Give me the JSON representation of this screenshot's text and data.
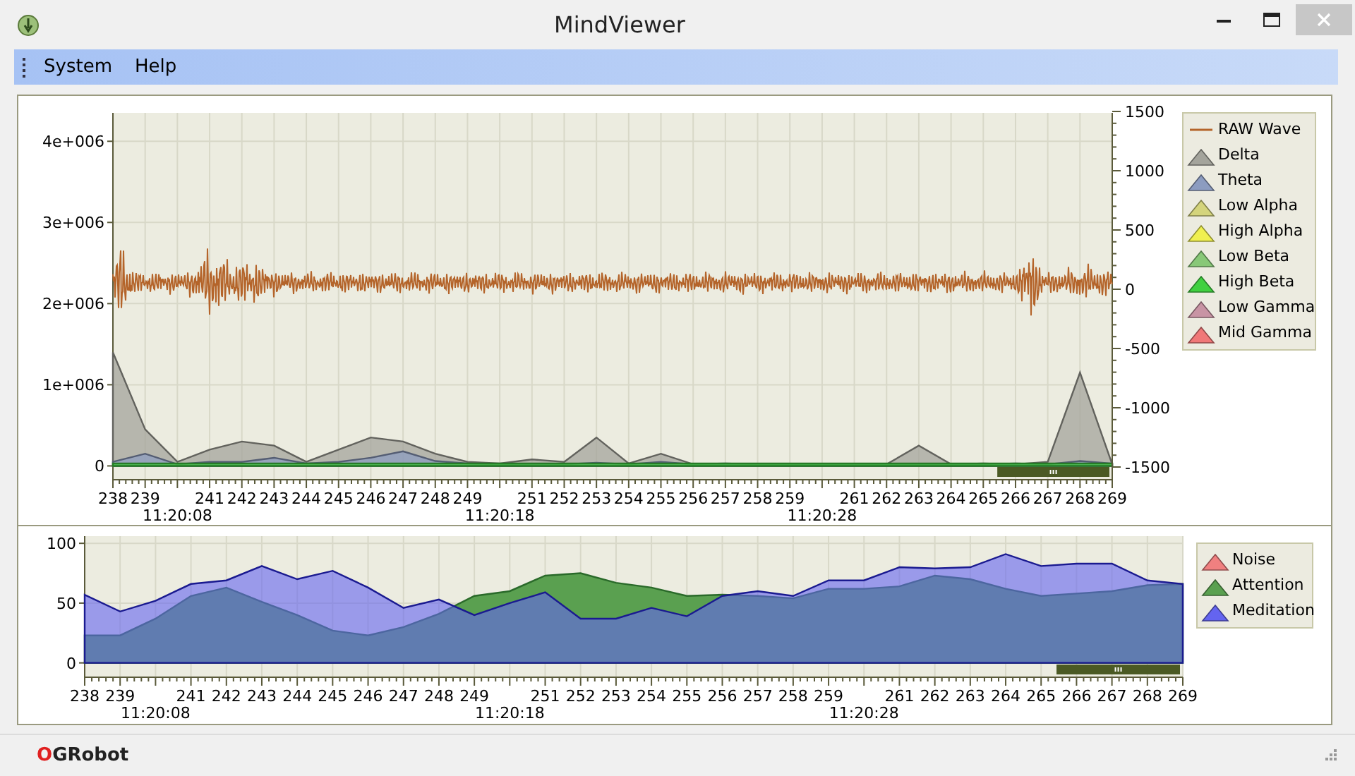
{
  "window": {
    "title": "MindViewer"
  },
  "menu": [
    {
      "label": "System"
    },
    {
      "label": "Help"
    }
  ],
  "wave_chart": {
    "raw_wave": {
      "name": "RAW Wave",
      "color": "#b4642a"
    },
    "right_ytick_labels": [
      "1500",
      "1000",
      "500",
      "0",
      "-500",
      "-1000",
      "-1500"
    ],
    "chart_data": {
      "type": "area",
      "stacked": false,
      "grid": true,
      "legend": true,
      "categories": [
        "238",
        "239",
        "11:20:08",
        "241",
        "242",
        "243",
        "244",
        "245",
        "246",
        "247",
        "248",
        "249",
        "11:20:18",
        "251",
        "252",
        "253",
        "254",
        "255",
        "256",
        "257",
        "258",
        "259",
        "11:20:28",
        "261",
        "262",
        "263",
        "264",
        "265",
        "266",
        "267",
        "268",
        "269"
      ],
      "ylim": [
        -170000,
        4350000
      ],
      "yticks": [
        {
          "value": 0,
          "label": "0"
        },
        {
          "value": 1000000,
          "label": "1e+006"
        },
        {
          "value": 2000000,
          "label": "2e+006"
        },
        {
          "value": 3000000,
          "label": "3e+006"
        },
        {
          "value": 4000000,
          "label": "4e+006"
        }
      ],
      "series": [
        {
          "name": "Delta",
          "color": "#a4a49c",
          "values": [
            1400000,
            450000,
            50000,
            200000,
            300000,
            250000,
            50000,
            200000,
            350000,
            300000,
            150000,
            50000,
            30000,
            80000,
            50000,
            350000,
            30000,
            150000,
            20000,
            20000,
            20000,
            20000,
            20000,
            20000,
            20000,
            250000,
            20000,
            30000,
            20000,
            50000,
            1150000,
            20000
          ]
        },
        {
          "name": "Theta",
          "color": "#8c9cc0",
          "values": [
            50000,
            150000,
            20000,
            50000,
            50000,
            100000,
            30000,
            50000,
            100000,
            180000,
            60000,
            30000,
            20000,
            20000,
            20000,
            40000,
            20000,
            50000,
            20000,
            30000,
            20000,
            20000,
            20000,
            20000,
            20000,
            20000,
            20000,
            20000,
            30000,
            20000,
            60000,
            30000
          ]
        },
        {
          "name": "Low Alpha",
          "color": "#d4d47c",
          "values": [
            null,
            null,
            null,
            null,
            null,
            null,
            null,
            null,
            null,
            null,
            null,
            null,
            null,
            null,
            null,
            null,
            null,
            null,
            null,
            null,
            null,
            null,
            null,
            null,
            null,
            null,
            null,
            null,
            null,
            null,
            null,
            null
          ]
        },
        {
          "name": "High Alpha",
          "color": "#f0f050",
          "values": [
            null,
            null,
            null,
            null,
            null,
            null,
            null,
            null,
            null,
            null,
            null,
            null,
            null,
            null,
            null,
            null,
            null,
            null,
            null,
            null,
            null,
            null,
            null,
            null,
            null,
            null,
            null,
            null,
            null,
            null,
            null,
            null
          ]
        },
        {
          "name": "Low Beta",
          "color": "#88c878",
          "values": [
            null,
            null,
            null,
            null,
            null,
            null,
            null,
            null,
            null,
            null,
            null,
            null,
            null,
            null,
            null,
            null,
            null,
            null,
            null,
            null,
            null,
            null,
            null,
            null,
            null,
            null,
            null,
            null,
            null,
            null,
            null,
            null
          ]
        },
        {
          "name": "High Beta",
          "color": "#40d040",
          "values": [
            30000,
            30000,
            30000,
            30000,
            30000,
            30000,
            30000,
            30000,
            30000,
            30000,
            30000,
            30000,
            30000,
            30000,
            30000,
            30000,
            30000,
            30000,
            30000,
            30000,
            30000,
            30000,
            30000,
            30000,
            30000,
            30000,
            30000,
            30000,
            30000,
            30000,
            30000,
            30000
          ]
        },
        {
          "name": "Low Gamma",
          "color": "#c894a4",
          "values": [
            null,
            null,
            null,
            null,
            null,
            null,
            null,
            null,
            null,
            null,
            null,
            null,
            null,
            null,
            null,
            null,
            null,
            null,
            null,
            null,
            null,
            null,
            null,
            null,
            null,
            null,
            null,
            null,
            null,
            null,
            null,
            null
          ]
        },
        {
          "name": "Mid Gamma",
          "color": "#f07878",
          "values": [
            null,
            null,
            null,
            null,
            null,
            null,
            null,
            null,
            null,
            null,
            null,
            null,
            null,
            null,
            null,
            null,
            null,
            null,
            null,
            null,
            null,
            null,
            null,
            null,
            null,
            null,
            null,
            null,
            null,
            null,
            null,
            null
          ]
        }
      ]
    }
  },
  "focus_chart": {
    "chart_data": {
      "type": "area",
      "stacked": false,
      "grid": true,
      "legend": true,
      "categories": [
        "238",
        "239",
        "11:20:08",
        "241",
        "242",
        "243",
        "244",
        "245",
        "246",
        "247",
        "248",
        "249",
        "11:20:18",
        "251",
        "252",
        "253",
        "254",
        "255",
        "256",
        "257",
        "258",
        "259",
        "11:20:28",
        "261",
        "262",
        "263",
        "264",
        "265",
        "266",
        "267",
        "268",
        "269"
      ],
      "ylim": [
        -12,
        106
      ],
      "yticks": [
        0,
        50,
        100
      ],
      "series": [
        {
          "name": "Noise",
          "color": "#f08080",
          "values": [
            null,
            null,
            null,
            null,
            null,
            null,
            null,
            null,
            null,
            null,
            null,
            null,
            null,
            null,
            null,
            null,
            null,
            null,
            null,
            null,
            null,
            null,
            null,
            null,
            null,
            null,
            null,
            null,
            null,
            null,
            null,
            null
          ]
        },
        {
          "name": "Attention",
          "color": "#5aa050",
          "values": [
            23,
            23,
            37,
            56,
            63,
            51,
            40,
            27,
            23,
            30,
            41,
            56,
            60,
            73,
            75,
            67,
            63,
            56,
            57,
            56,
            54,
            62,
            62,
            64,
            73,
            70,
            62,
            56,
            58,
            60,
            65,
            66
          ]
        },
        {
          "name": "Meditation",
          "color": "#6464f0",
          "values": [
            57,
            43,
            52,
            66,
            69,
            81,
            70,
            77,
            63,
            46,
            53,
            40,
            50,
            59,
            37,
            37,
            46,
            39,
            56,
            60,
            56,
            69,
            69,
            80,
            79,
            80,
            91,
            81,
            83,
            83,
            69,
            66
          ]
        }
      ]
    }
  },
  "status_bar": {
    "brand": "OGRobot"
  }
}
